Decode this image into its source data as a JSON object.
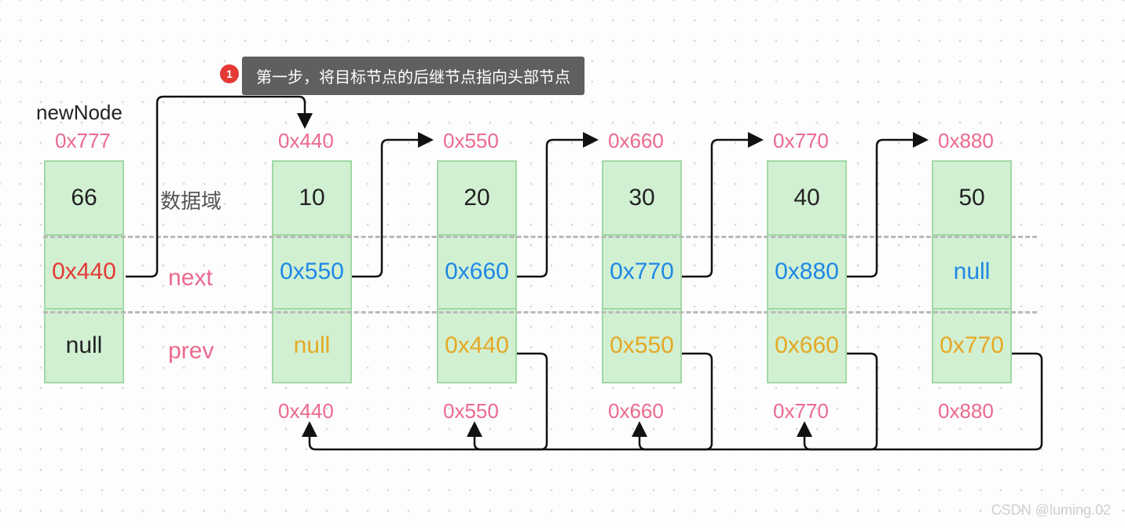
{
  "step": {
    "num": "1",
    "text": "第一步，将目标节点的后继节点指向头部节点"
  },
  "newNodeLabel": "newNode",
  "rowLabels": {
    "data": "数据域",
    "next": "next",
    "prev": "prev"
  },
  "newNode": {
    "addr": "0x777",
    "data": "66",
    "next": "0x440",
    "prev": "null"
  },
  "nodes": [
    {
      "addr": "0x440",
      "data": "10",
      "next": "0x550",
      "prev": "null"
    },
    {
      "addr": "0x550",
      "data": "20",
      "next": "0x660",
      "prev": "0x440"
    },
    {
      "addr": "0x660",
      "data": "30",
      "next": "0x770",
      "prev": "0x550"
    },
    {
      "addr": "0x770",
      "data": "40",
      "next": "0x880",
      "prev": "0x660"
    },
    {
      "addr": "0x880",
      "data": "50",
      "next": "null",
      "prev": "0x770"
    }
  ],
  "watermark": "CSDN @luming.02",
  "layout": {
    "newX": 56,
    "startX": 346,
    "gap": 210,
    "nodeTop": 204,
    "cellH": 96,
    "nodeW": 98
  }
}
